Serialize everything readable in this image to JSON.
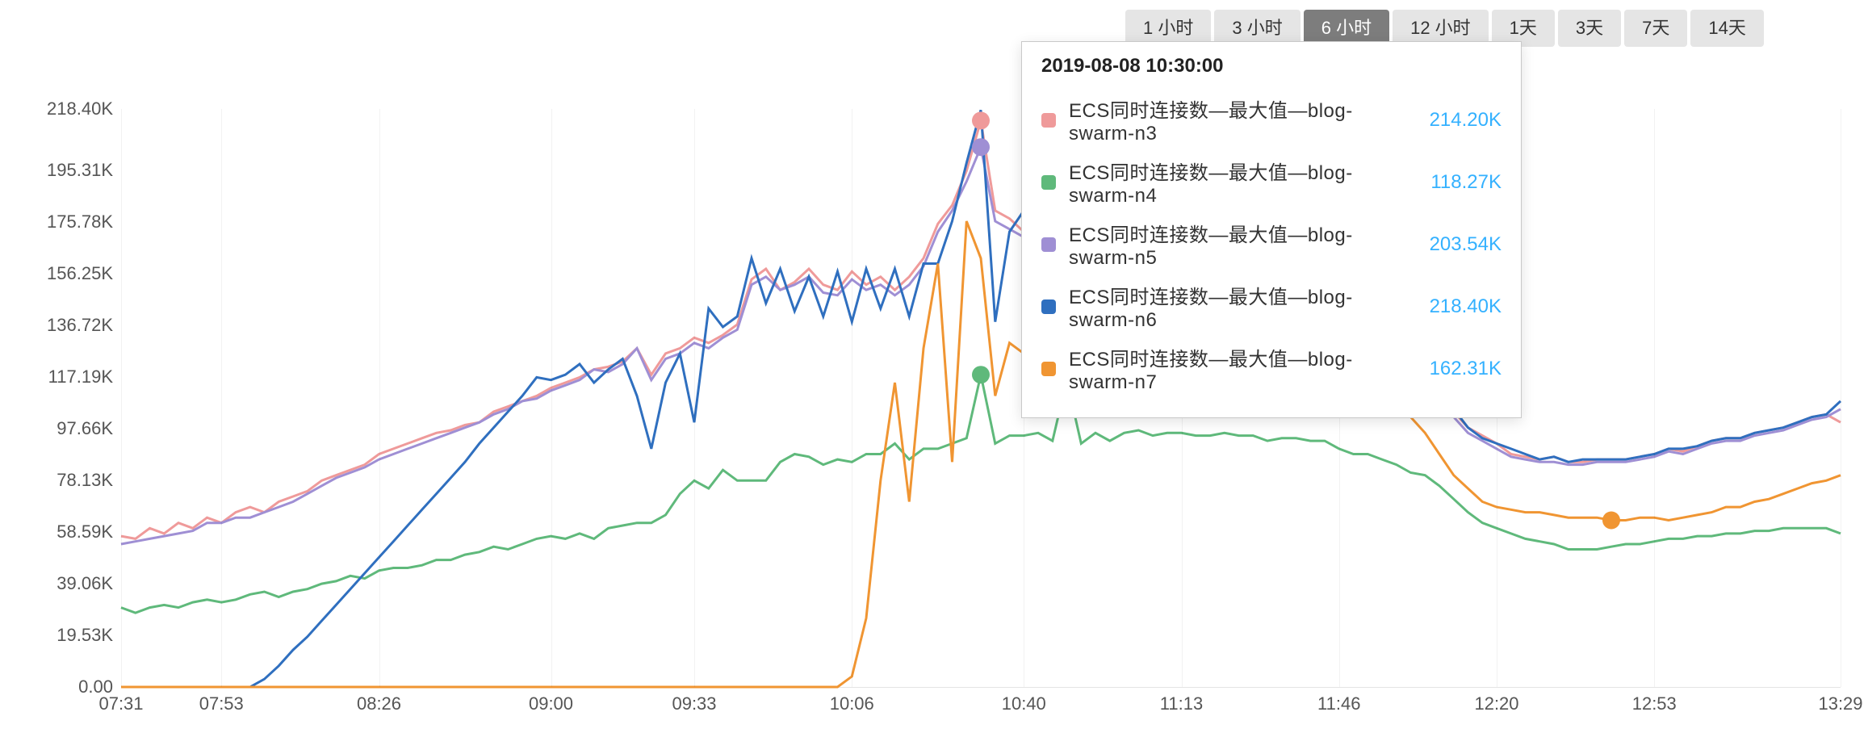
{
  "time_ranges": {
    "items": [
      "1 小时",
      "3 小时",
      "6 小时",
      "12 小时",
      "1天",
      "3天",
      "7天",
      "14天"
    ],
    "active_index": 2
  },
  "tooltip": {
    "title": "2019-08-08 10:30:00",
    "rows": [
      {
        "label": "ECS同时连接数—最大值—blog-swarm-n3",
        "value": "214.20K",
        "color": "#ef9a9a"
      },
      {
        "label": "ECS同时连接数—最大值—blog-swarm-n4",
        "value": "118.27K",
        "color": "#5fb97b"
      },
      {
        "label": "ECS同时连接数—最大值—blog-swarm-n5",
        "value": "203.54K",
        "color": "#9f8fd4"
      },
      {
        "label": "ECS同时连接数—最大值—blog-swarm-n6",
        "value": "218.40K",
        "color": "#2f6fbf"
      },
      {
        "label": "ECS同时连接数—最大值—blog-swarm-n7",
        "value": "162.31K",
        "color": "#f09532"
      }
    ]
  },
  "chart_data": {
    "type": "line",
    "xlabel": "",
    "ylabel": "",
    "yticks": [
      0.0,
      19.53,
      39.06,
      58.59,
      78.13,
      97.66,
      117.19,
      136.72,
      156.25,
      175.78,
      195.31,
      218.4
    ],
    "ytick_labels": [
      "0.00",
      "19.53K",
      "39.06K",
      "58.59K",
      "78.13K",
      "97.66K",
      "117.19K",
      "136.72K",
      "156.25K",
      "175.78K",
      "195.31K",
      "218.40K"
    ],
    "ylim": [
      0,
      218.4
    ],
    "x": [
      "07:31",
      "07:34",
      "07:37",
      "07:40",
      "07:43",
      "07:46",
      "07:49",
      "07:52",
      "07:55",
      "07:58",
      "08:01",
      "08:04",
      "08:07",
      "08:10",
      "08:13",
      "08:16",
      "08:19",
      "08:22",
      "08:25",
      "08:28",
      "08:31",
      "08:34",
      "08:37",
      "08:40",
      "08:43",
      "08:46",
      "08:49",
      "08:52",
      "08:55",
      "08:58",
      "09:01",
      "09:04",
      "09:07",
      "09:10",
      "09:13",
      "09:16",
      "09:19",
      "09:22",
      "09:25",
      "09:28",
      "09:31",
      "09:34",
      "09:37",
      "09:40",
      "09:43",
      "09:46",
      "09:49",
      "09:52",
      "09:55",
      "09:58",
      "10:01",
      "10:04",
      "10:07",
      "10:10",
      "10:13",
      "10:16",
      "10:19",
      "10:22",
      "10:25",
      "10:28",
      "10:30",
      "10:33",
      "10:36",
      "10:39",
      "10:42",
      "10:45",
      "10:48",
      "10:51",
      "10:54",
      "10:57",
      "11:00",
      "11:03",
      "11:06",
      "11:09",
      "11:12",
      "11:15",
      "11:18",
      "11:21",
      "11:24",
      "11:27",
      "11:30",
      "11:33",
      "11:36",
      "11:39",
      "11:42",
      "11:45",
      "11:48",
      "11:51",
      "11:54",
      "11:57",
      "12:00",
      "12:03",
      "12:06",
      "12:09",
      "12:12",
      "12:15",
      "12:18",
      "12:21",
      "12:24",
      "12:27",
      "12:30",
      "12:33",
      "12:36",
      "12:39",
      "12:42",
      "12:45",
      "12:48",
      "12:51",
      "12:54",
      "12:57",
      "13:00",
      "13:03",
      "13:06",
      "13:09",
      "13:12",
      "13:15",
      "13:18",
      "13:21",
      "13:24",
      "13:27",
      "13:29"
    ],
    "xticks": [
      "07:31",
      "07:53",
      "08:26",
      "09:00",
      "09:33",
      "10:06",
      "10:40",
      "11:13",
      "11:46",
      "12:20",
      "12:53",
      "13:29"
    ],
    "xtick_indices": [
      0,
      7,
      18,
      30,
      40,
      51,
      63,
      74,
      85,
      96,
      107,
      120
    ],
    "cursor_index": 60,
    "series": [
      {
        "name": "ECS同时连接数—最大值—blog-swarm-n3",
        "color": "#ef9a9a",
        "values": [
          57,
          56,
          60,
          58,
          62,
          60,
          64,
          62,
          66,
          68,
          66,
          70,
          72,
          74,
          78,
          80,
          82,
          84,
          88,
          90,
          92,
          94,
          96,
          97,
          99,
          100,
          104,
          106,
          108,
          110,
          113,
          115,
          117,
          120,
          121,
          123,
          128,
          118,
          126,
          128,
          132,
          130,
          133,
          137,
          154,
          158,
          150,
          153,
          158,
          152,
          150,
          157,
          152,
          155,
          150,
          155,
          162,
          175,
          182,
          195,
          214,
          180,
          177,
          172,
          195,
          176,
          172,
          178,
          160,
          176,
          172,
          170,
          175,
          167,
          170,
          165,
          167,
          172,
          170,
          170,
          165,
          167,
          165,
          171,
          165,
          166,
          158,
          156,
          148,
          140,
          138,
          128,
          116,
          104,
          98,
          95,
          92,
          88,
          87,
          86,
          87,
          85,
          85,
          86,
          86,
          86,
          87,
          88,
          90,
          89,
          91,
          93,
          94,
          94,
          96,
          97,
          98,
          100,
          102,
          103,
          100
        ]
      },
      {
        "name": "ECS同时连接数—最大值—blog-swarm-n4",
        "color": "#5fb97b",
        "values": [
          30,
          28,
          30,
          31,
          30,
          32,
          33,
          32,
          33,
          35,
          36,
          34,
          36,
          37,
          39,
          40,
          42,
          41,
          44,
          45,
          45,
          46,
          48,
          48,
          50,
          51,
          53,
          52,
          54,
          56,
          57,
          56,
          58,
          56,
          60,
          61,
          62,
          62,
          65,
          73,
          78,
          75,
          82,
          78,
          78,
          78,
          85,
          88,
          87,
          84,
          86,
          85,
          88,
          88,
          92,
          86,
          90,
          90,
          92,
          94,
          118,
          92,
          95,
          95,
          96,
          93,
          116,
          92,
          96,
          93,
          96,
          97,
          95,
          96,
          96,
          95,
          95,
          96,
          95,
          95,
          93,
          94,
          94,
          93,
          93,
          90,
          88,
          88,
          86,
          84,
          81,
          80,
          76,
          71,
          66,
          62,
          60,
          58,
          56,
          55,
          54,
          52,
          52,
          52,
          53,
          54,
          54,
          55,
          56,
          56,
          57,
          57,
          58,
          58,
          59,
          59,
          60,
          60,
          60,
          60,
          58
        ]
      },
      {
        "name": "ECS同时连接数—最大值—blog-swarm-n5",
        "color": "#9f8fd4",
        "values": [
          54,
          55,
          56,
          57,
          58,
          59,
          62,
          62,
          64,
          64,
          66,
          68,
          70,
          73,
          76,
          79,
          81,
          83,
          86,
          88,
          90,
          92,
          94,
          96,
          98,
          100,
          103,
          105,
          108,
          109,
          112,
          114,
          116,
          120,
          119,
          122,
          128,
          116,
          124,
          126,
          130,
          128,
          132,
          135,
          152,
          155,
          150,
          152,
          155,
          149,
          148,
          154,
          150,
          152,
          148,
          152,
          159,
          172,
          180,
          191,
          204,
          176,
          173,
          170,
          193,
          173,
          169,
          175,
          158,
          173,
          170,
          168,
          172,
          164,
          168,
          163,
          165,
          170,
          168,
          168,
          163,
          165,
          163,
          170,
          163,
          164,
          156,
          154,
          147,
          139,
          136,
          127,
          115,
          102,
          96,
          93,
          90,
          87,
          86,
          85,
          85,
          84,
          84,
          85,
          85,
          85,
          86,
          87,
          89,
          88,
          90,
          92,
          93,
          93,
          95,
          96,
          97,
          99,
          101,
          102,
          105
        ]
      },
      {
        "name": "ECS同时连接数—最大值—blog-swarm-n6",
        "color": "#2f6fbf",
        "values": [
          0,
          0,
          0,
          0,
          0,
          0,
          0,
          0,
          0,
          0,
          3,
          8,
          14,
          19,
          25,
          31,
          37,
          43,
          49,
          55,
          61,
          67,
          73,
          79,
          85,
          92,
          98,
          104,
          110,
          117,
          116,
          118,
          122,
          115,
          120,
          124,
          110,
          90,
          115,
          126,
          100,
          143,
          136,
          140,
          162,
          145,
          158,
          142,
          155,
          140,
          157,
          138,
          158,
          143,
          158,
          140,
          160,
          160,
          176,
          198,
          218,
          138,
          172,
          180,
          192,
          185,
          165,
          173,
          162,
          170,
          176,
          170,
          172,
          168,
          170,
          167,
          165,
          168,
          170,
          168,
          164,
          168,
          166,
          170,
          164,
          165,
          160,
          150,
          148,
          144,
          138,
          130,
          120,
          105,
          98,
          94,
          92,
          90,
          88,
          86,
          87,
          85,
          86,
          86,
          86,
          86,
          87,
          88,
          90,
          90,
          91,
          93,
          94,
          94,
          96,
          97,
          98,
          100,
          102,
          103,
          108
        ]
      },
      {
        "name": "ECS同时连接数—最大值—blog-swarm-n7",
        "color": "#f09532",
        "values": [
          0,
          0,
          0,
          0,
          0,
          0,
          0,
          0,
          0,
          0,
          0,
          0,
          0,
          0,
          0,
          0,
          0,
          0,
          0,
          0,
          0,
          0,
          0,
          0,
          0,
          0,
          0,
          0,
          0,
          0,
          0,
          0,
          0,
          0,
          0,
          0,
          0,
          0,
          0,
          0,
          0,
          0,
          0,
          0,
          0,
          0,
          0,
          0,
          0,
          0,
          0,
          4,
          26,
          78,
          115,
          70,
          128,
          160,
          85,
          176,
          162,
          110,
          130,
          126,
          130,
          115,
          137,
          122,
          124,
          128,
          126,
          128,
          127,
          125,
          128,
          124,
          127,
          126,
          125,
          125,
          124,
          125,
          124,
          127,
          124,
          124,
          120,
          118,
          111,
          106,
          102,
          96,
          88,
          80,
          75,
          70,
          68,
          67,
          66,
          66,
          65,
          64,
          64,
          64,
          63,
          63,
          64,
          64,
          63,
          64,
          65,
          66,
          68,
          68,
          70,
          71,
          73,
          75,
          77,
          78,
          80
        ]
      }
    ],
    "highlight_markers": [
      {
        "series": 0,
        "x_index": 60,
        "level": "201"
      },
      {
        "series": 1,
        "x_index": 60,
        "level": "118.27"
      },
      {
        "series": 2,
        "x_index": 60,
        "level": "195"
      },
      {
        "series": 3,
        "x_index": 87,
        "level": "150"
      },
      {
        "series": 4,
        "x_index": 104,
        "level": "63"
      }
    ]
  }
}
